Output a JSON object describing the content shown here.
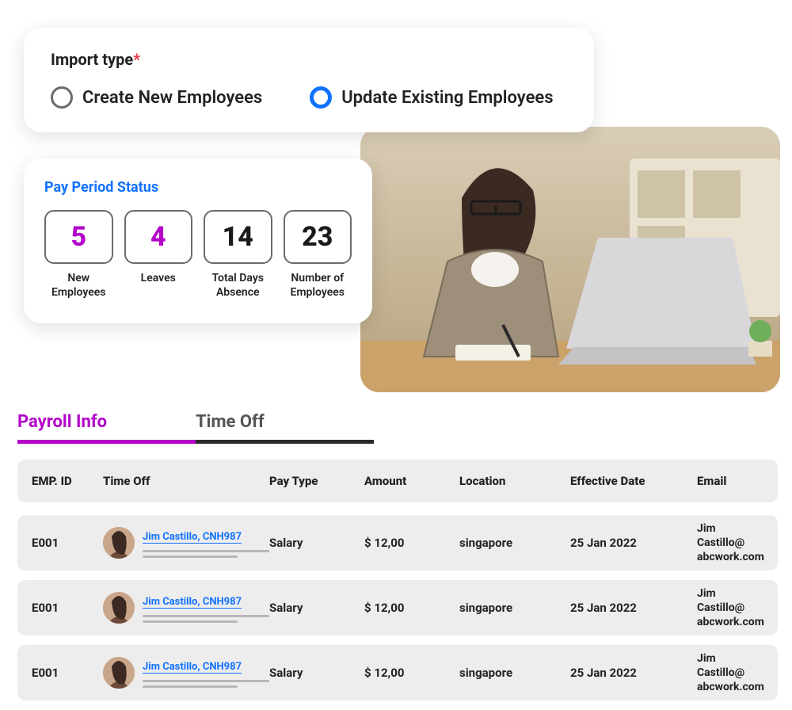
{
  "import": {
    "label": "Import type",
    "options": [
      {
        "label": "Create New Employees",
        "selected": false
      },
      {
        "label": "Update Existing Employees",
        "selected": true
      }
    ]
  },
  "pay_period": {
    "title": "Pay Period Status",
    "stats": [
      {
        "value": "5",
        "label_l1": "New",
        "label_l2": "Employees",
        "color": "magenta"
      },
      {
        "value": "4",
        "label_l1": "Leaves",
        "label_l2": "",
        "color": "magenta"
      },
      {
        "value": "14",
        "label_l1": "Total Days",
        "label_l2": "Absence",
        "color": "dark"
      },
      {
        "value": "23",
        "label_l1": "Number of",
        "label_l2": "Employees",
        "color": "dark"
      }
    ]
  },
  "tabs": [
    {
      "label": "Payroll Info",
      "active": true
    },
    {
      "label": "Time Off",
      "active": false
    }
  ],
  "table": {
    "headers": {
      "emp_id": "EMP. ID",
      "time_off": "Time Off",
      "pay_type": "Pay Type",
      "amount": "Amount",
      "location": "Location",
      "eff_date": "Effective Date",
      "email": "Email"
    },
    "rows": [
      {
        "emp_id": "E001",
        "name": "Jim Castillo, CNH987",
        "pay_type": "Salary",
        "amount": "$ 12,00",
        "location": "singapore",
        "eff_date": "25 Jan 2022",
        "email_l1": "Jim Castillo@",
        "email_l2": "abcwork.com"
      },
      {
        "emp_id": "E001",
        "name": "Jim Castillo, CNH987",
        "pay_type": "Salary",
        "amount": "$ 12,00",
        "location": "singapore",
        "eff_date": "25 Jan 2022",
        "email_l1": "Jim Castillo@",
        "email_l2": "abcwork.com"
      },
      {
        "emp_id": "E001",
        "name": "Jim Castillo, CNH987",
        "pay_type": "Salary",
        "amount": "$ 12,00",
        "location": "singapore",
        "eff_date": "25 Jan 2022",
        "email_l1": "Jim Castillo@",
        "email_l2": "abcwork.com"
      }
    ]
  }
}
